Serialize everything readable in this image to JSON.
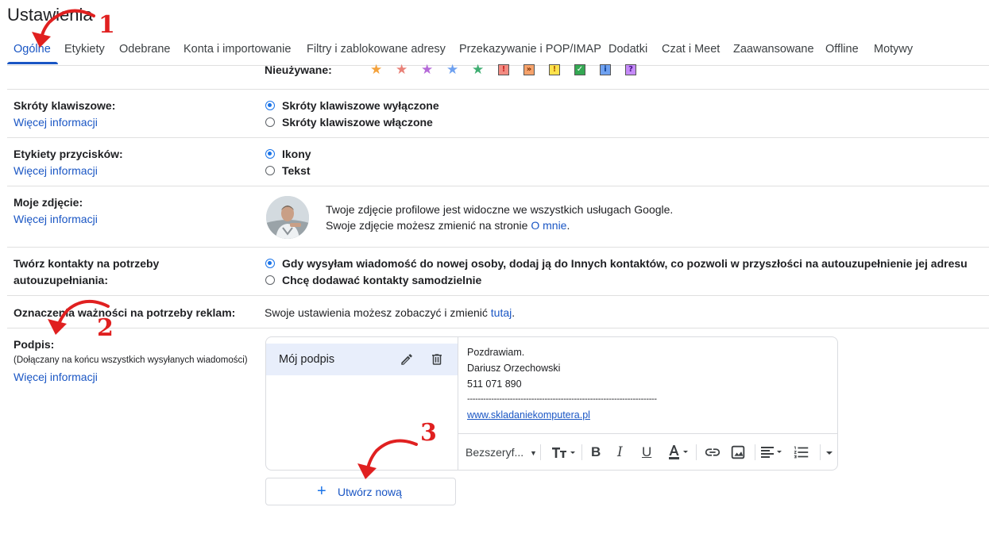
{
  "page": {
    "title": "Ustawienia"
  },
  "tabs": [
    "Ogólne",
    "Etykiety",
    "Odebrane",
    "Konta i importowanie",
    "Filtry i zablokowane adresy",
    "Przekazywanie i POP/IMAP",
    "Dodatki",
    "Czat i Meet",
    "Zaawansowane",
    "Offline",
    "Motywy"
  ],
  "active_tab": "Ogólne",
  "stars": {
    "label": "Nieużywane:",
    "items": [
      {
        "icon": "orange-star-icon",
        "color": "#f4a23c"
      },
      {
        "icon": "red-star-icon",
        "color": "#e98178"
      },
      {
        "icon": "purple-star-icon",
        "color": "#b56ad8"
      },
      {
        "icon": "blue-star-icon",
        "color": "#6fa1f0"
      },
      {
        "icon": "green-star-icon",
        "color": "#3fae72"
      },
      {
        "icon": "red-bang-icon",
        "glyph": "!",
        "bg": "#f28b82"
      },
      {
        "icon": "orange-guillemet-icon",
        "glyph": "»",
        "bg": "#f6a26b"
      },
      {
        "icon": "yellow-bang-icon",
        "glyph": "!",
        "bg": "#fce24c"
      },
      {
        "icon": "green-check-icon",
        "glyph": "✓",
        "bg": "#34a853"
      },
      {
        "icon": "blue-info-icon",
        "glyph": "i",
        "bg": "#6fa1f0"
      },
      {
        "icon": "purple-question-icon",
        "glyph": "?",
        "bg": "#c58af9"
      }
    ]
  },
  "more_info": "Więcej informacji",
  "shortcuts": {
    "label": "Skróty klawiszowe:",
    "options": [
      "Skróty klawiszowe wyłączone",
      "Skróty klawiszowe włączone"
    ],
    "selected": 0
  },
  "button_labels": {
    "label": "Etykiety przycisków:",
    "options": [
      "Ikony",
      "Tekst"
    ],
    "selected": 0
  },
  "photo": {
    "label": "Moje zdjęcie:",
    "line1": "Twoje zdjęcie profilowe jest widoczne we wszystkich usługach Google.",
    "line2_prefix": "Swoje zdjęcie możesz zmienić na stronie ",
    "line2_link": "O mnie",
    "line2_suffix": "."
  },
  "contacts": {
    "label_line1": "Twórz kontakty na potrzeby",
    "label_line2": "autouzupełniania:",
    "options": [
      "Gdy wysyłam wiadomość do nowej osoby, dodaj ją do Innych kontaktów, co pozwoli w przyszłości na autouzupełnienie jej adresu",
      "Chcę dodawać kontakty samodzielnie"
    ],
    "selected": 0
  },
  "ads": {
    "label": "Oznaczenia ważności na potrzeby reklam:",
    "text": "Swoje ustawienia możesz zobaczyć i zmienić ",
    "link": "tutaj",
    "suffix": "."
  },
  "signature": {
    "label": "Podpis:",
    "note": "(Dołączany na końcu wszystkich wysyłanych wiadomości)",
    "items": [
      "Mój podpis"
    ],
    "content": [
      "Pozdrawiam.",
      "Dariusz Orzechowski",
      "511 071 890",
      "-----------------------------------------------------------------------",
      "www.skladaniekomputera.pl"
    ],
    "toolbar": {
      "font": "Bezszeryf...",
      "tools": [
        "text-size-icon",
        "bold-icon",
        "italic-icon",
        "underline-icon",
        "text-color-icon",
        "link-icon",
        "image-icon",
        "align-icon",
        "numbered-list-icon",
        "more-options-icon"
      ]
    },
    "create_label": "Utwórz nową"
  },
  "annotations": [
    "1",
    "2",
    "3"
  ],
  "colors": {
    "accent": "#1a73e8",
    "link": "#1a56c4",
    "annotation": "#e02020",
    "selected_row": "#e8eefb"
  }
}
